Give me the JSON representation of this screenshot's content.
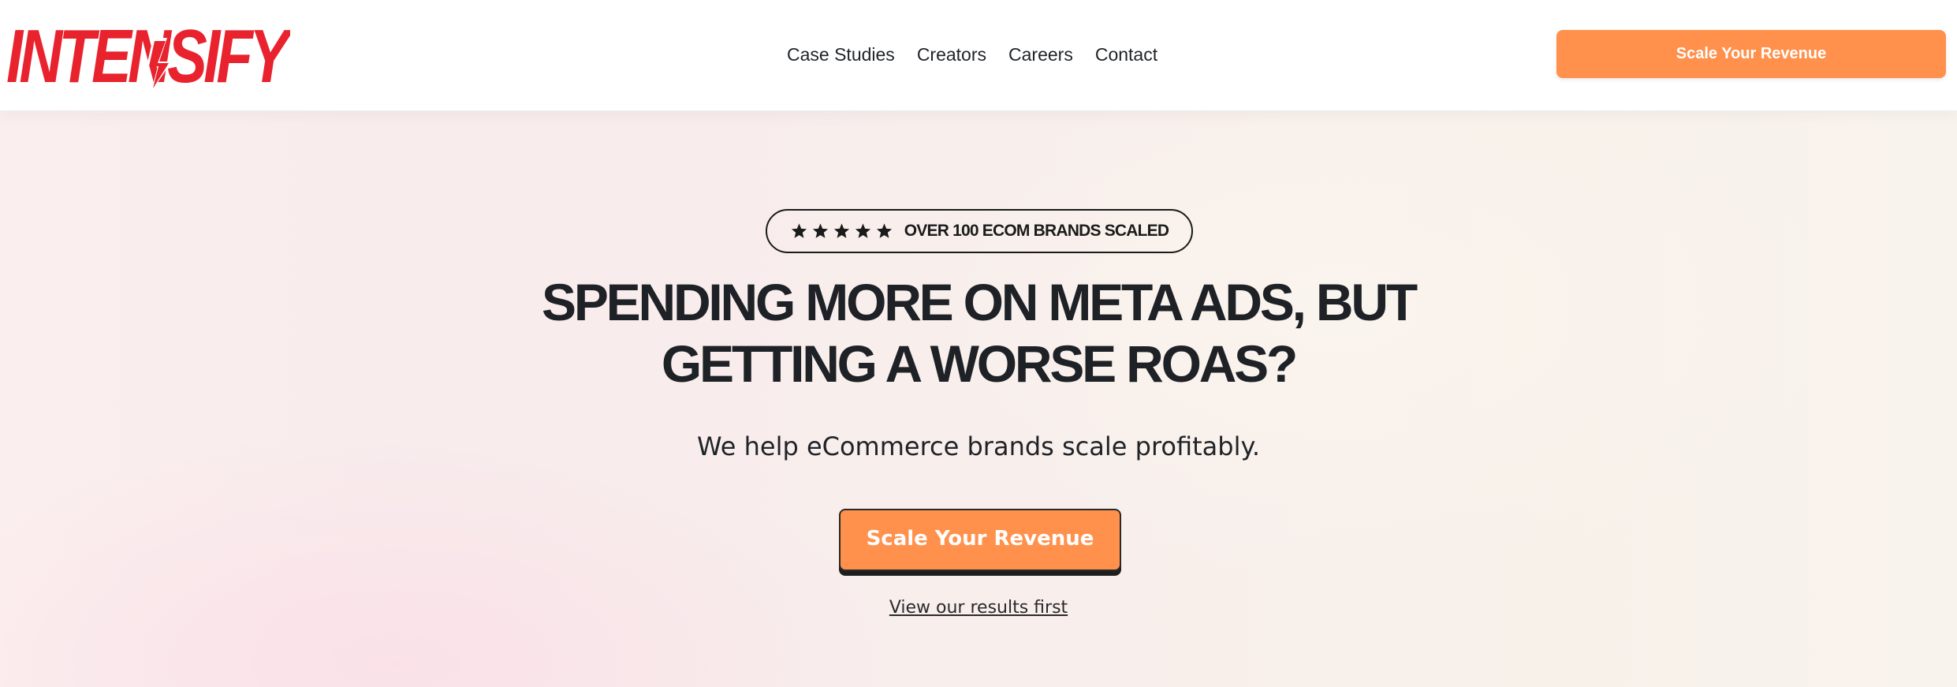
{
  "brand": {
    "logo_text": "INTENSIFY",
    "logo_color": "#e8232e"
  },
  "nav": {
    "items": [
      {
        "label": "Case Studies"
      },
      {
        "label": "Creators"
      },
      {
        "label": "Careers"
      },
      {
        "label": "Contact"
      }
    ]
  },
  "header": {
    "cta_label": "Scale Your Revenue"
  },
  "hero": {
    "badge": {
      "rating": 5,
      "text": "OVER 100 ECOM BRANDS SCALED"
    },
    "headline_line1": "SPENDING MORE ON META ADS, BUT",
    "headline_line2": "GETTING A WORSE ROAS?",
    "subheadline": "We help eCommerce brands scale profitably.",
    "cta_label": "Scale Your Revenue",
    "secondary_link": "View our results first"
  },
  "colors": {
    "accent": "#ff914d",
    "text_dark": "#1e2125"
  }
}
